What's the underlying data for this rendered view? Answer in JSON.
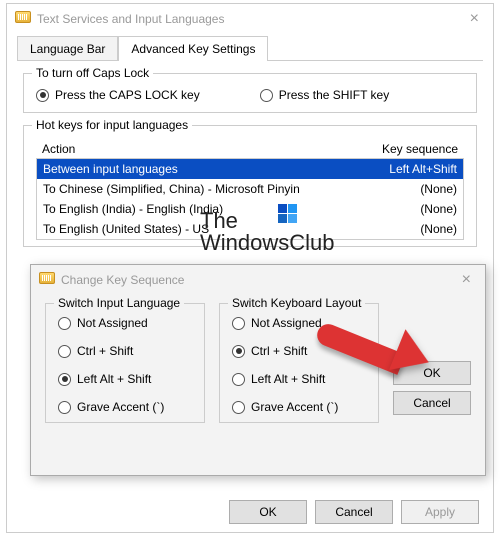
{
  "mainWindow": {
    "title": "Text Services and Input Languages",
    "tabs": [
      "Language Bar",
      "Advanced Key Settings"
    ],
    "activeTab": 1,
    "capslockGroup": {
      "legend": "To turn off Caps Lock",
      "opt1": "Press the CAPS LOCK key",
      "opt2": "Press the SHIFT key",
      "selected": 0
    },
    "hotkeysGroup": {
      "legend": "Hot keys for input languages",
      "headAction": "Action",
      "headSeq": "Key sequence",
      "rows": [
        {
          "action": "Between input languages",
          "seq": "Left Alt+Shift",
          "selected": true
        },
        {
          "action": "To Chinese (Simplified, China) - Microsoft Pinyin",
          "seq": "(None)",
          "selected": false
        },
        {
          "action": "To English (India) - English (India)",
          "seq": "(None)",
          "selected": false
        },
        {
          "action": "To English (United States) - US",
          "seq": "(None)",
          "selected": false
        }
      ]
    },
    "buttons": {
      "ok": "OK",
      "cancel": "Cancel",
      "apply": "Apply"
    }
  },
  "subWindow": {
    "title": "Change Key Sequence",
    "group1": {
      "legend": "Switch Input Language",
      "opts": [
        "Not Assigned",
        "Ctrl + Shift",
        "Left Alt + Shift",
        "Grave Accent (`)"
      ],
      "selected": 2
    },
    "group2": {
      "legend": "Switch Keyboard Layout",
      "opts": [
        "Not Assigned",
        "Ctrl + Shift",
        "Left Alt + Shift",
        "Grave Accent (`)"
      ],
      "selected": 1
    },
    "buttons": {
      "ok": "OK",
      "cancel": "Cancel"
    }
  },
  "watermark": {
    "line1": "The",
    "line2": "WindowsClub"
  }
}
